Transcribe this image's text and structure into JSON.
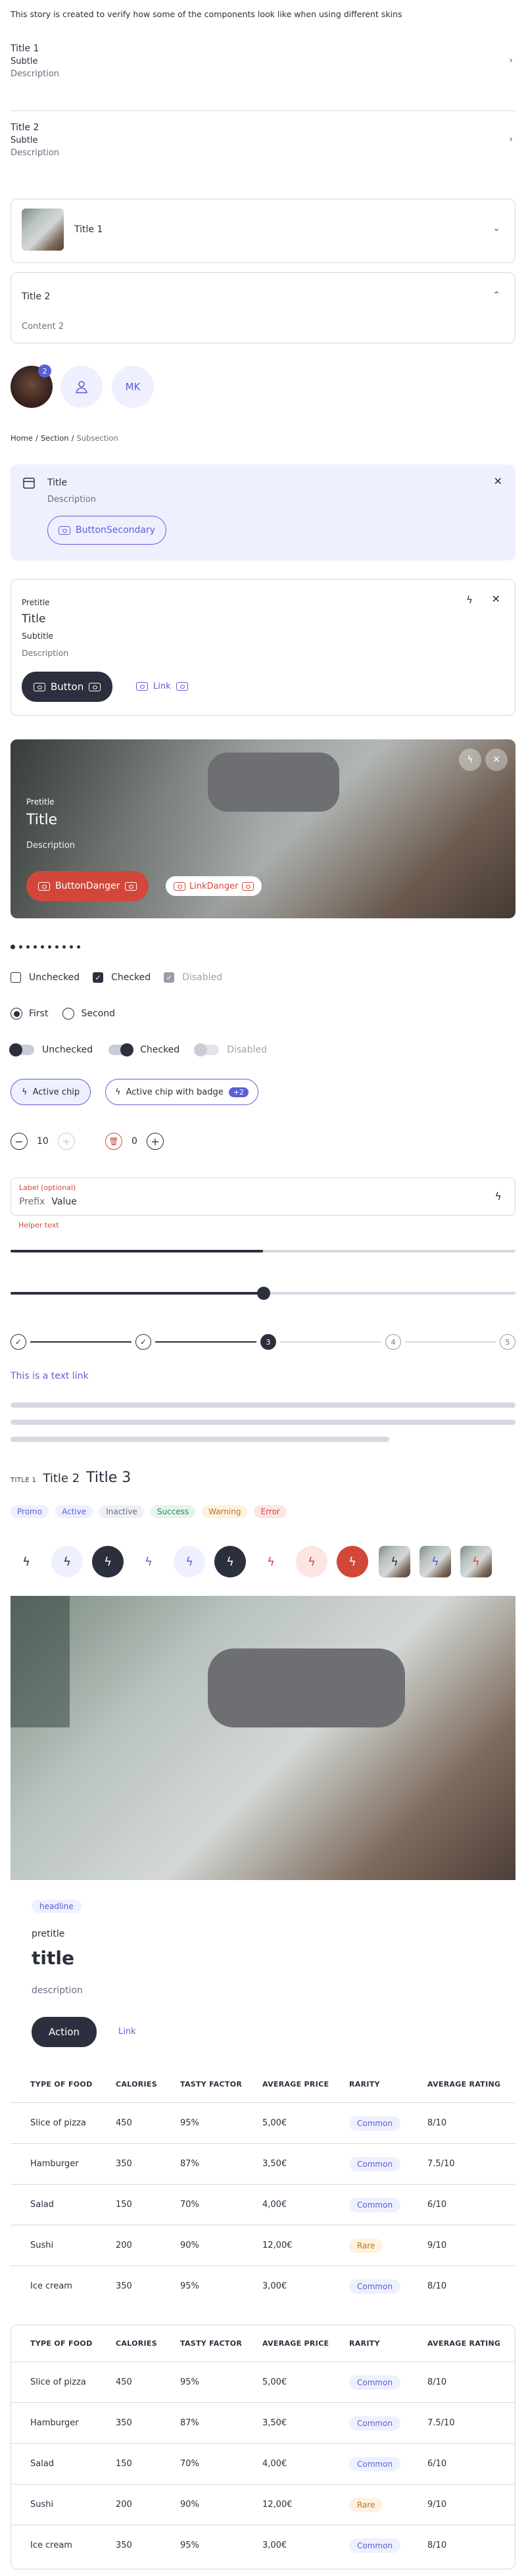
{
  "intro": "This story is created to verify how some of the components look like when using different skins",
  "list": [
    {
      "title": "Title 1",
      "subtitle": "Subtle",
      "description": "Description"
    },
    {
      "title": "Title 2",
      "subtitle": "Subtle",
      "description": "Description"
    }
  ],
  "accordion": [
    {
      "title": "Title 1"
    },
    {
      "title": "Title 2",
      "content": "Content 2"
    }
  ],
  "avatars": {
    "badge": "2",
    "initials": "MK"
  },
  "breadcrumb": {
    "home": "Home",
    "section": "Section",
    "current": "Subsection",
    "sep": "/"
  },
  "callout": {
    "title": "Title",
    "description": "Description",
    "button": "ButtonSecondary"
  },
  "card1": {
    "pretitle": "Pretitle",
    "title": "Title",
    "subtitle": "Subtitle",
    "description": "Description",
    "button": "Button",
    "link": "Link"
  },
  "media_card": {
    "pretitle": "Pretitle",
    "title": "Title",
    "description": "Description",
    "button": "ButtonDanger",
    "link": "LinkDanger"
  },
  "checkboxes": {
    "unchecked": "Unchecked",
    "checked": "Checked",
    "disabled": "Disabled"
  },
  "radios": {
    "first": "First",
    "second": "Second"
  },
  "switches": {
    "unchecked": "Unchecked",
    "checked": "Checked",
    "disabled": "Disabled"
  },
  "chips": {
    "active": "Active chip",
    "badge_chip": "Active chip with badge",
    "badge": "+2"
  },
  "steppers": {
    "v1": "10",
    "v2": "0"
  },
  "field": {
    "label": "Label (optional)",
    "prefix": "Prefix",
    "value": "Value",
    "helper": "Helper text"
  },
  "stepper_steps": [
    "3",
    "4",
    "5"
  ],
  "text_link": "This is a text link",
  "titles": {
    "t1": "TITLE 1",
    "t2": "Title 2",
    "t3": "Title 3"
  },
  "tags": [
    "Promo",
    "Active",
    "Inactive",
    "Success",
    "Warning",
    "Error"
  ],
  "hero": {
    "headline": "headline",
    "pretitle": "pretitle",
    "title": "title",
    "description": "description",
    "action": "Action",
    "link": "Link"
  },
  "table": {
    "headers": [
      "TYPE OF FOOD",
      "CALORIES",
      "TASTY FACTOR",
      "AVERAGE PRICE",
      "RARITY",
      "AVERAGE RATING"
    ],
    "rows": [
      [
        "Slice of pizza",
        "450",
        "95%",
        "5,00€",
        "Common",
        "8/10"
      ],
      [
        "Hamburger",
        "350",
        "87%",
        "3,50€",
        "Common",
        "7.5/10"
      ],
      [
        "Salad",
        "150",
        "70%",
        "4,00€",
        "Common",
        "6/10"
      ],
      [
        "Sushi",
        "200",
        "90%",
        "12,00€",
        "Rare",
        "9/10"
      ],
      [
        "Ice cream",
        "350",
        "95%",
        "3,00€",
        "Common",
        "8/10"
      ]
    ]
  },
  "colors": {
    "accent": "#5b5fd6",
    "dark": "#2c2f3e",
    "danger": "#d2473a",
    "callout_bg": "#eef0ff"
  }
}
